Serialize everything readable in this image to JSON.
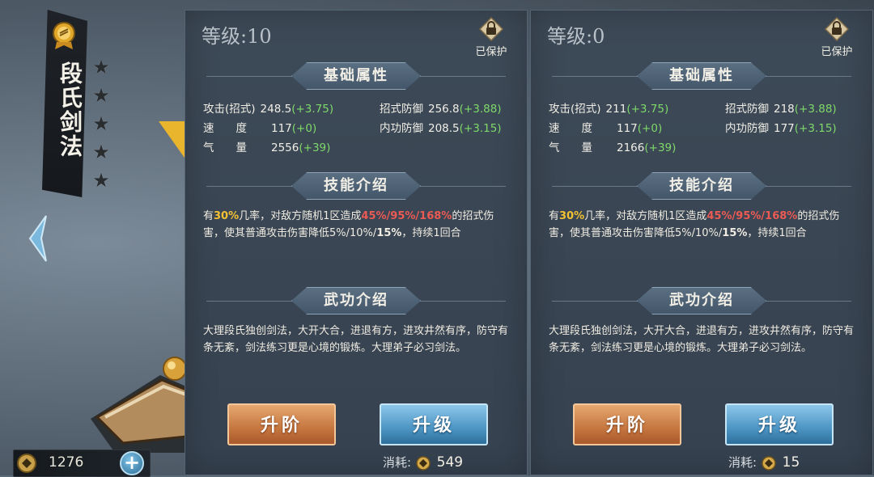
{
  "skill": {
    "name": "段氏剑法",
    "stars": 5
  },
  "currency": {
    "value": "1276"
  },
  "panels": [
    {
      "level_label": "等级:10",
      "protect_label": "已保护",
      "sections": {
        "basic": "基础属性",
        "skill": "技能介绍",
        "martial": "武功介绍"
      },
      "stats": {
        "attack_label": "攻击(招式)",
        "attack_value": "248.5",
        "attack_bonus": "(+3.75)",
        "speed_label": "速　　度",
        "speed_value": "117",
        "speed_bonus": "(+0)",
        "qi_label": "气　　量",
        "qi_value": "2556",
        "qi_bonus": "(+39)",
        "move_def_label": "招式防御",
        "move_def_value": "256.8",
        "move_def_bonus": "(+3.88)",
        "inner_def_label": "内功防御",
        "inner_def_value": "208.5",
        "inner_def_bonus": "(+3.15)"
      },
      "skill_desc": {
        "p1": "有",
        "chance": "30%",
        "p2": "几率，对敌方随机1区造成",
        "dmg": "45%/95%/168%",
        "p3": "的招式伤害，使其普通攻击伤害降低5%/10%/",
        "reduce": "15%",
        "p4": "，持续1回合"
      },
      "martial_desc": "大理段氏独创剑法，大开大合，进退有方，进攻井然有序，防守有条无紊，剑法练习更是心境的锻炼。大理弟子必习剑法。",
      "advance_label": "升阶",
      "upgrade_label": "升级",
      "cost_label": "消耗:",
      "cost_value": "549"
    },
    {
      "level_label": "等级:0",
      "protect_label": "已保护",
      "sections": {
        "basic": "基础属性",
        "skill": "技能介绍",
        "martial": "武功介绍"
      },
      "stats": {
        "attack_label": "攻击(招式)",
        "attack_value": "211",
        "attack_bonus": "(+3.75)",
        "speed_label": "速　　度",
        "speed_value": "117",
        "speed_bonus": "(+0)",
        "qi_label": "气　　量",
        "qi_value": "2166",
        "qi_bonus": "(+39)",
        "move_def_label": "招式防御",
        "move_def_value": "218",
        "move_def_bonus": "(+3.88)",
        "inner_def_label": "内功防御",
        "inner_def_value": "177",
        "inner_def_bonus": "(+3.15)"
      },
      "skill_desc": {
        "p1": "有",
        "chance": "30%",
        "p2": "几率，对敌方随机1区造成",
        "dmg": "45%/95%/168%",
        "p3": "的招式伤害，使其普通攻击伤害降低5%/10%/",
        "reduce": "15%",
        "p4": "，持续1回合"
      },
      "martial_desc": "大理段氏独创剑法，大开大合，进退有方，进攻井然有序，防守有条无紊，剑法练习更是心境的锻炼。大理弟子必习剑法。",
      "advance_label": "升阶",
      "upgrade_label": "升级",
      "cost_label": "消耗:",
      "cost_value": "15"
    }
  ],
  "icons": {
    "medal": "medal-icon",
    "star": "star-icon",
    "arrow": "left-arrow-icon",
    "lock": "lock-icon",
    "coin": "coin-icon",
    "plus": "plus-icon"
  },
  "colors": {
    "bonus": "#7fd96a",
    "highlight_yellow": "#f2c233",
    "highlight_red": "#ec5a54"
  }
}
